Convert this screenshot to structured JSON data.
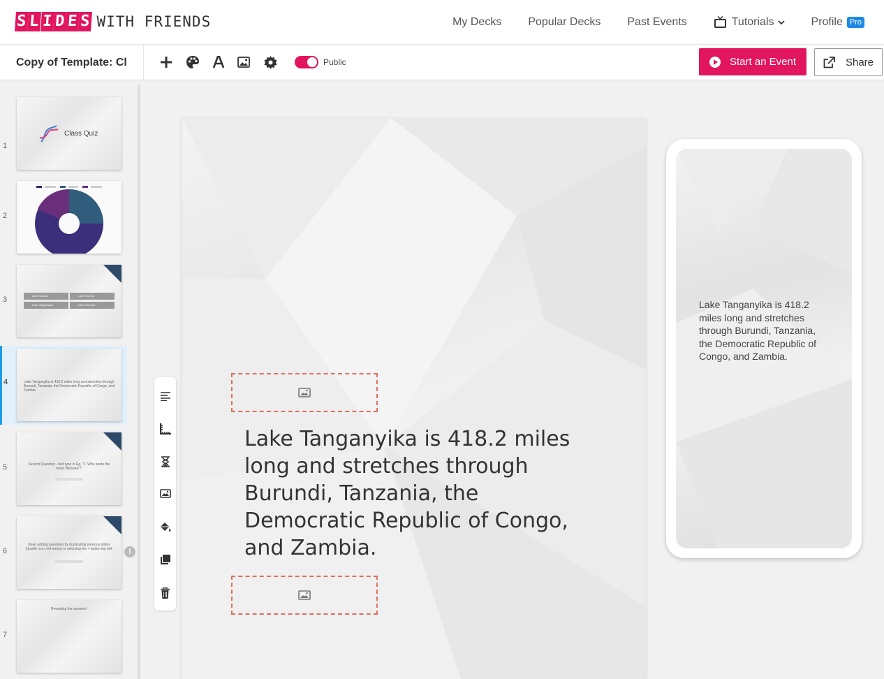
{
  "app": {
    "logo_tiles": [
      "S",
      "L",
      "I",
      "D",
      "E",
      "S"
    ],
    "logo_rest": "WITH FRIENDS",
    "brand_color": "#e2165e"
  },
  "nav": {
    "my_decks": "My Decks",
    "popular_decks": "Popular Decks",
    "past_events": "Past Events",
    "tutorials": "Tutorials",
    "profile": "Profile",
    "pro_badge": "Pro"
  },
  "toolbar": {
    "deck_title": "Copy of Template: Cl",
    "public_label": "Public",
    "public_on": true,
    "start_event": "Start an Event",
    "share": "Share",
    "icons": [
      "plus-icon",
      "palette-icon",
      "font-icon",
      "image-icon",
      "gear-icon"
    ]
  },
  "slides": [
    {
      "num": "1",
      "text": "Class Quiz"
    },
    {
      "num": "2",
      "text": ""
    },
    {
      "num": "3",
      "text": ""
    },
    {
      "num": "4",
      "text": "Lake Tanganyika is 418.2 miles long and stretches through Burundi, Tanzania, the Democratic Republic of Congo, and Zambia."
    },
    {
      "num": "5",
      "text": "Second Question - text type in Eg. \"2. Who wrote the novel 'Beloved'?\""
    },
    {
      "num": "6",
      "text": "Keep adding questions by duplicating previous slides (double icon, left menu) or selecting the + button top left."
    },
    {
      "num": "7",
      "text": "Revealing the answers!"
    }
  ],
  "slide3_options": [
    "Lake Malawi",
    "Lake Victoria",
    "Lake Tanganyika",
    "Lake Turkana"
  ],
  "current_slide": {
    "index": 4,
    "text": "Lake Tanganyika is 418.2 miles long and stretches through Burundi, Tanzania, the Democratic Republic of Congo, and Zambia."
  },
  "preview": {
    "text": "Lake Tanganyika is 418.2 miles long and stretches through Burundi, Tanzania, the Democratic Republic of Congo, and Zambia."
  },
  "side_tools": [
    "align-left-icon",
    "ruler-icon",
    "hourglass-icon",
    "image-icon",
    "paint-bucket-icon",
    "duplicate-icon",
    "trash-icon"
  ],
  "alert_icon": "!"
}
